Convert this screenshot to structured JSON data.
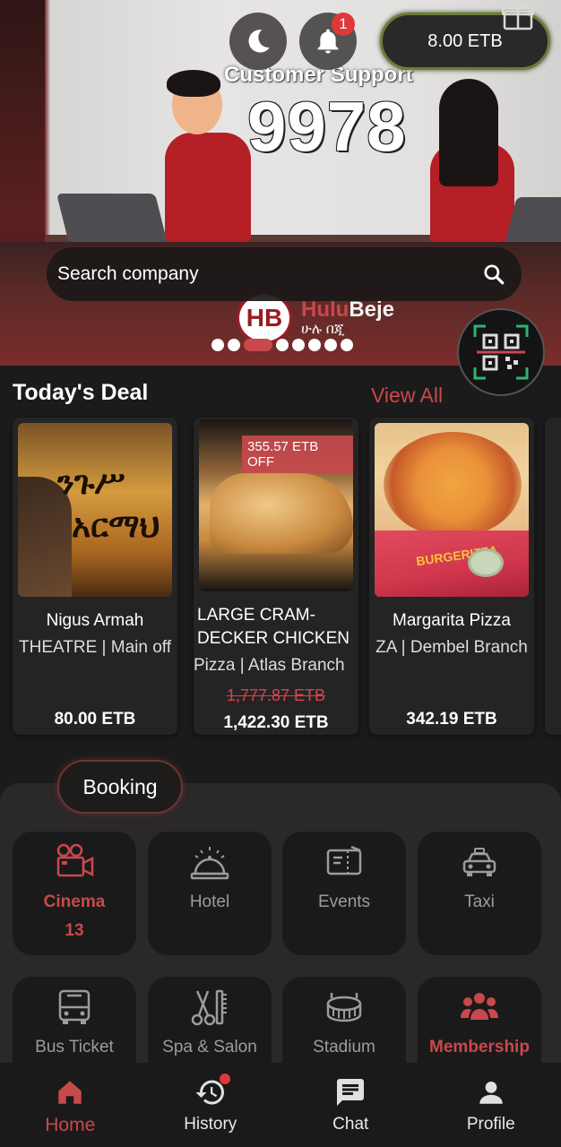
{
  "header": {
    "wallet_balance": "8.00 ETB",
    "notification_count": "1",
    "icons": [
      "moon-icon",
      "bell-icon",
      "gift-icon",
      "search-icon",
      "qr-code-icon"
    ]
  },
  "banner": {
    "support_title": "Customer Support",
    "support_number": "9978",
    "logo_mark": "HB",
    "logo_name_a": "Hulu",
    "logo_name_b": "Beje",
    "logo_sub": "ሁሉ በጂ",
    "slide_count": 8,
    "active_slide": 3
  },
  "search": {
    "placeholder": "Search company"
  },
  "deals": {
    "title": "Today's Deal",
    "view_all": "View All",
    "items": [
      {
        "name": "Nigus Armah",
        "subtitle": "THEATRE | Main off",
        "price": "80.00 ETB",
        "image_text_1": "ንጉሥ",
        "image_text_2": "አርማህ"
      },
      {
        "name_line1": "LARGE CRAM-",
        "name_line2": "DECKER CHICKEN",
        "subtitle": "Pizza | Atlas Branch",
        "old_price": "1,777.87 ETB",
        "price": "1,422.30 ETB",
        "badge": "355.57 ETB OFF"
      },
      {
        "name": "Margarita Pizza",
        "subtitle": "ZA | Dembel Branch",
        "price": "342.19 ETB",
        "box_text": "BURGERIZZA"
      }
    ]
  },
  "booking": {
    "title": "Booking",
    "tiles": [
      {
        "label": "Cinema",
        "count": "13",
        "icon": "movie-camera-icon",
        "selected": true
      },
      {
        "label": "Hotel",
        "icon": "reception-bell-icon"
      },
      {
        "label": "Events",
        "icon": "ticket-icon"
      },
      {
        "label": "Taxi",
        "icon": "taxi-icon"
      },
      {
        "label": "Bus Ticket",
        "icon": "bus-icon"
      },
      {
        "label": "Spa & Salon",
        "icon": "scissors-comb-icon"
      },
      {
        "label": "Stadium",
        "icon": "stadium-icon"
      },
      {
        "label": "Membership",
        "icon": "people-group-icon",
        "highlight": true
      }
    ]
  },
  "nav": {
    "items": [
      {
        "label": "Home",
        "icon": "home-icon",
        "active": true
      },
      {
        "label": "History",
        "icon": "history-icon"
      },
      {
        "label": "Chat",
        "icon": "chat-icon"
      },
      {
        "label": "Profile",
        "icon": "profile-icon"
      }
    ]
  },
  "colors": {
    "accent": "#c7494c",
    "background": "#1c1b1b",
    "tile": "#1b1a1a",
    "badge": "#e0383a"
  }
}
